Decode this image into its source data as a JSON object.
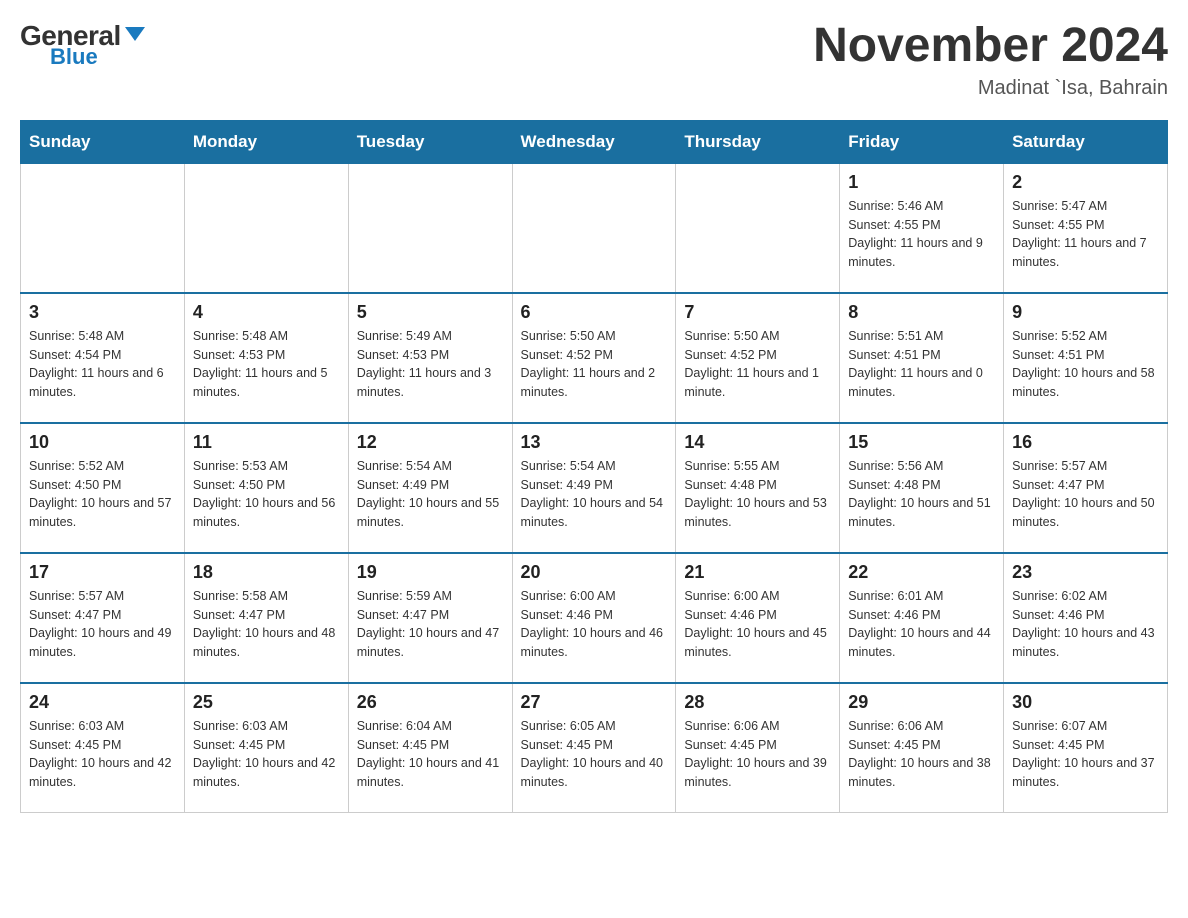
{
  "header": {
    "logo_general": "General",
    "logo_blue": "Blue",
    "month_year": "November 2024",
    "location": "Madinat `Isa, Bahrain"
  },
  "days_of_week": [
    "Sunday",
    "Monday",
    "Tuesday",
    "Wednesday",
    "Thursday",
    "Friday",
    "Saturday"
  ],
  "weeks": [
    [
      {
        "day": "",
        "info": ""
      },
      {
        "day": "",
        "info": ""
      },
      {
        "day": "",
        "info": ""
      },
      {
        "day": "",
        "info": ""
      },
      {
        "day": "",
        "info": ""
      },
      {
        "day": "1",
        "info": "Sunrise: 5:46 AM\nSunset: 4:55 PM\nDaylight: 11 hours and 9 minutes."
      },
      {
        "day": "2",
        "info": "Sunrise: 5:47 AM\nSunset: 4:55 PM\nDaylight: 11 hours and 7 minutes."
      }
    ],
    [
      {
        "day": "3",
        "info": "Sunrise: 5:48 AM\nSunset: 4:54 PM\nDaylight: 11 hours and 6 minutes."
      },
      {
        "day": "4",
        "info": "Sunrise: 5:48 AM\nSunset: 4:53 PM\nDaylight: 11 hours and 5 minutes."
      },
      {
        "day": "5",
        "info": "Sunrise: 5:49 AM\nSunset: 4:53 PM\nDaylight: 11 hours and 3 minutes."
      },
      {
        "day": "6",
        "info": "Sunrise: 5:50 AM\nSunset: 4:52 PM\nDaylight: 11 hours and 2 minutes."
      },
      {
        "day": "7",
        "info": "Sunrise: 5:50 AM\nSunset: 4:52 PM\nDaylight: 11 hours and 1 minute."
      },
      {
        "day": "8",
        "info": "Sunrise: 5:51 AM\nSunset: 4:51 PM\nDaylight: 11 hours and 0 minutes."
      },
      {
        "day": "9",
        "info": "Sunrise: 5:52 AM\nSunset: 4:51 PM\nDaylight: 10 hours and 58 minutes."
      }
    ],
    [
      {
        "day": "10",
        "info": "Sunrise: 5:52 AM\nSunset: 4:50 PM\nDaylight: 10 hours and 57 minutes."
      },
      {
        "day": "11",
        "info": "Sunrise: 5:53 AM\nSunset: 4:50 PM\nDaylight: 10 hours and 56 minutes."
      },
      {
        "day": "12",
        "info": "Sunrise: 5:54 AM\nSunset: 4:49 PM\nDaylight: 10 hours and 55 minutes."
      },
      {
        "day": "13",
        "info": "Sunrise: 5:54 AM\nSunset: 4:49 PM\nDaylight: 10 hours and 54 minutes."
      },
      {
        "day": "14",
        "info": "Sunrise: 5:55 AM\nSunset: 4:48 PM\nDaylight: 10 hours and 53 minutes."
      },
      {
        "day": "15",
        "info": "Sunrise: 5:56 AM\nSunset: 4:48 PM\nDaylight: 10 hours and 51 minutes."
      },
      {
        "day": "16",
        "info": "Sunrise: 5:57 AM\nSunset: 4:47 PM\nDaylight: 10 hours and 50 minutes."
      }
    ],
    [
      {
        "day": "17",
        "info": "Sunrise: 5:57 AM\nSunset: 4:47 PM\nDaylight: 10 hours and 49 minutes."
      },
      {
        "day": "18",
        "info": "Sunrise: 5:58 AM\nSunset: 4:47 PM\nDaylight: 10 hours and 48 minutes."
      },
      {
        "day": "19",
        "info": "Sunrise: 5:59 AM\nSunset: 4:47 PM\nDaylight: 10 hours and 47 minutes."
      },
      {
        "day": "20",
        "info": "Sunrise: 6:00 AM\nSunset: 4:46 PM\nDaylight: 10 hours and 46 minutes."
      },
      {
        "day": "21",
        "info": "Sunrise: 6:00 AM\nSunset: 4:46 PM\nDaylight: 10 hours and 45 minutes."
      },
      {
        "day": "22",
        "info": "Sunrise: 6:01 AM\nSunset: 4:46 PM\nDaylight: 10 hours and 44 minutes."
      },
      {
        "day": "23",
        "info": "Sunrise: 6:02 AM\nSunset: 4:46 PM\nDaylight: 10 hours and 43 minutes."
      }
    ],
    [
      {
        "day": "24",
        "info": "Sunrise: 6:03 AM\nSunset: 4:45 PM\nDaylight: 10 hours and 42 minutes."
      },
      {
        "day": "25",
        "info": "Sunrise: 6:03 AM\nSunset: 4:45 PM\nDaylight: 10 hours and 42 minutes."
      },
      {
        "day": "26",
        "info": "Sunrise: 6:04 AM\nSunset: 4:45 PM\nDaylight: 10 hours and 41 minutes."
      },
      {
        "day": "27",
        "info": "Sunrise: 6:05 AM\nSunset: 4:45 PM\nDaylight: 10 hours and 40 minutes."
      },
      {
        "day": "28",
        "info": "Sunrise: 6:06 AM\nSunset: 4:45 PM\nDaylight: 10 hours and 39 minutes."
      },
      {
        "day": "29",
        "info": "Sunrise: 6:06 AM\nSunset: 4:45 PM\nDaylight: 10 hours and 38 minutes."
      },
      {
        "day": "30",
        "info": "Sunrise: 6:07 AM\nSunset: 4:45 PM\nDaylight: 10 hours and 37 minutes."
      }
    ]
  ]
}
